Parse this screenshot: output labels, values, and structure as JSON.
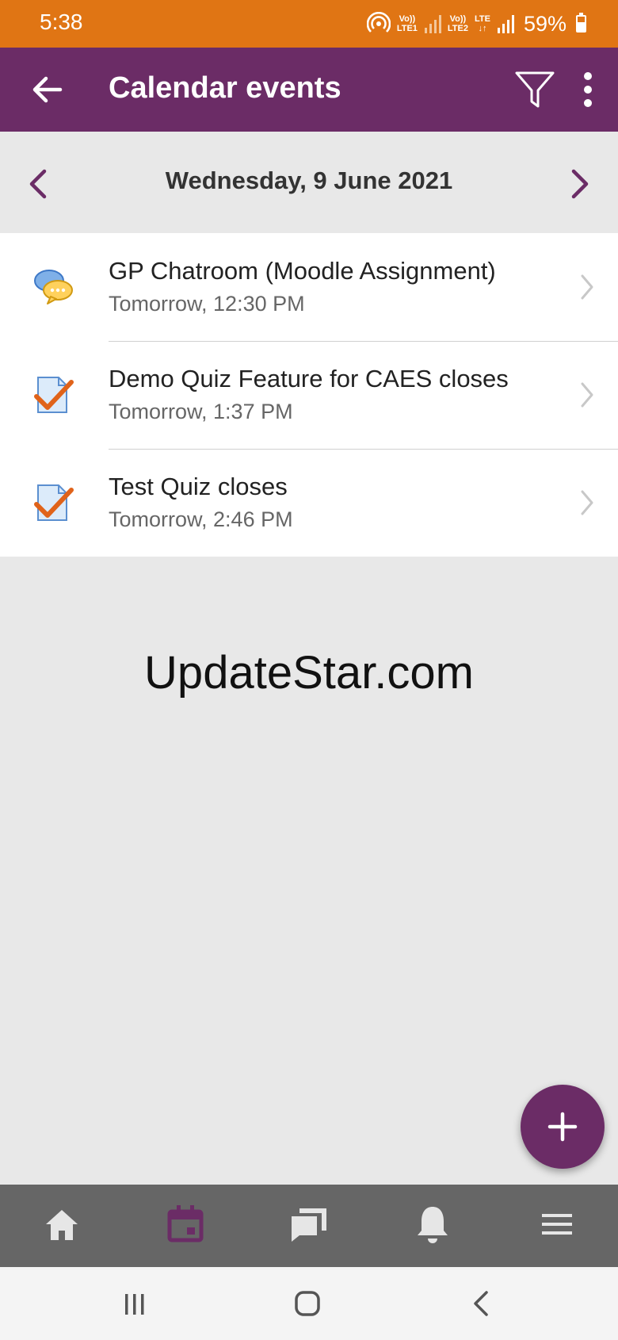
{
  "status_bar": {
    "time": "5:38",
    "sim1_label_top": "Vo))",
    "sim1_label_bottom": "LTE1",
    "sim2_label_top": "Vo))",
    "sim2_label_bottom": "LTE2",
    "lte_label": "LTE",
    "battery": "59%",
    "battery_level": 0.59,
    "color": "#e07514"
  },
  "app_bar": {
    "title": "Calendar events",
    "back_icon": "arrow-left-icon",
    "filter_icon": "filter-icon",
    "more_icon": "more-vert-icon",
    "color": "#6b2c66"
  },
  "date_nav": {
    "date": "Wednesday, 9 June 2021",
    "prev_icon": "chevron-left-icon",
    "next_icon": "chevron-right-icon"
  },
  "events": [
    {
      "title": "GP Chatroom (Moodle Assignment)",
      "time": "Tomorrow, 12:30 PM",
      "icon": "chat-icon"
    },
    {
      "title": "Demo Quiz Feature for CAES closes",
      "time": "Tomorrow, 1:37 PM",
      "icon": "quiz-icon"
    },
    {
      "title": "Test Quiz closes",
      "time": "Tomorrow, 2:46 PM",
      "icon": "quiz-icon"
    }
  ],
  "watermark": "UpdateStar.com",
  "fab": {
    "icon": "plus-icon"
  },
  "bottom_nav": [
    {
      "name": "home",
      "icon": "home-icon",
      "active": false
    },
    {
      "name": "calendar",
      "icon": "calendar-icon",
      "active": true
    },
    {
      "name": "messages",
      "icon": "messages-icon",
      "active": false
    },
    {
      "name": "notifications",
      "icon": "bell-icon",
      "active": false
    },
    {
      "name": "menu",
      "icon": "menu-icon",
      "active": false
    }
  ],
  "system_nav": [
    "recents-icon",
    "home-circle-icon",
    "back-chevron-icon"
  ]
}
